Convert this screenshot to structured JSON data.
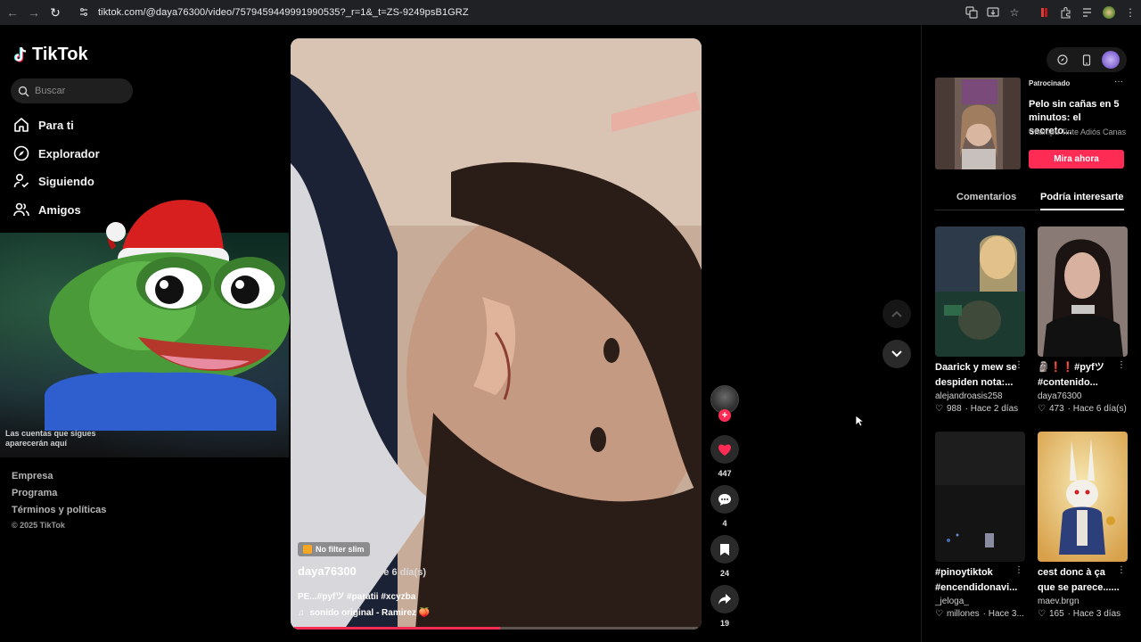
{
  "browser": {
    "url": "tiktok.com/@daya76300/video/7579459449991990535?_r=1&_t=ZS-9249psB1GRZ"
  },
  "sidebar": {
    "logo_text": "TikTok",
    "search_placeholder": "Buscar",
    "nav": [
      {
        "label": "Para ti",
        "icon": "home-icon"
      },
      {
        "label": "Explorador",
        "icon": "compass-icon"
      },
      {
        "label": "Siguiendo",
        "icon": "following-icon"
      },
      {
        "label": "Amigos",
        "icon": "friends-icon"
      }
    ],
    "note": "Las cuentas que sigues aparecerán aquí",
    "footer": [
      "Empresa",
      "Programa",
      "Términos y políticas"
    ],
    "copyright": "© 2025 TikTok"
  },
  "video": {
    "effect_label": "No filter slim",
    "author": "daya76300",
    "time": "· Hace 6 día(s)",
    "tags": "PE...#pyfツ #paratii #xcyzba",
    "sound": "sonido original - Ramirez 🍑",
    "progress": 0.51
  },
  "actions": {
    "likes": "447",
    "comments": "4",
    "saves": "24",
    "shares": "19"
  },
  "ad": {
    "sponsored": "Patrocinado",
    "title": "Pelo sin cañas en 5 minutos: el secreto...",
    "brand": "Champú Tinte Adiós Canas",
    "cta": "Mira ahora"
  },
  "tabs": {
    "comments": "Comentarios",
    "interesting": "Podría interesarte"
  },
  "cards": [
    {
      "title": "Daarick y mew se despiden nota:...",
      "author": "alejandroasis258",
      "likes": "988",
      "time": "· Hace 2 días"
    },
    {
      "title": "🗿❗❗#pyfツ #contenido...",
      "author": "daya76300",
      "likes": "473",
      "time": "· Hace 6 día(s)"
    },
    {
      "title": "#pinoytiktok #encendidonavi...",
      "author": "_jeloga_",
      "likes": "millones",
      "time": "· Hace 3..."
    },
    {
      "title": "cest donc à ça que se parece......",
      "author": "maev.brgn",
      "likes": "165",
      "time": "· Hace 3 días"
    }
  ],
  "colors": {
    "accent": "#fe2c55",
    "background": "#000000",
    "browser_bar": "#202124"
  }
}
